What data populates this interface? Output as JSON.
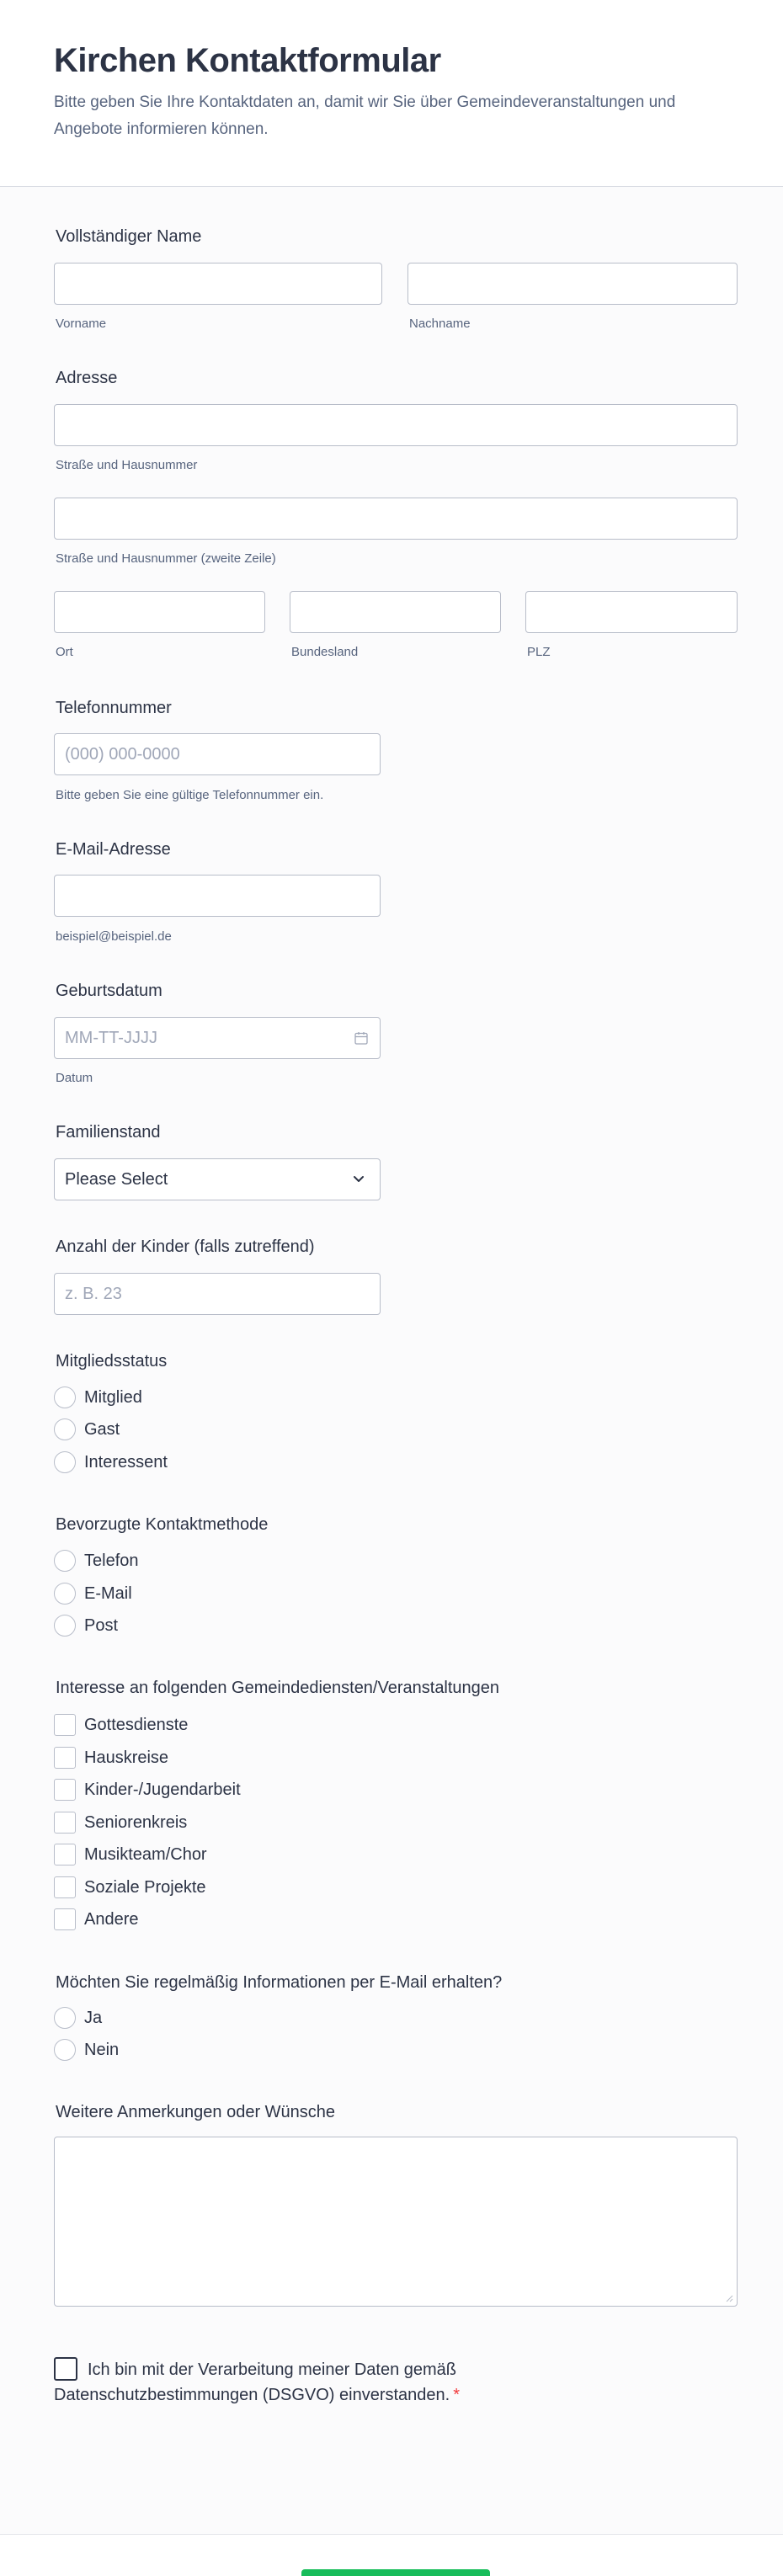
{
  "header": {
    "title": "Kirchen Kontaktformular",
    "subtitle": "Bitte geben Sie Ihre Kontaktdaten an, damit wir Sie über Gemeindeveranstaltungen und Angebote informieren können."
  },
  "name": {
    "label": "Vollständiger Name",
    "first_sublabel": "Vorname",
    "last_sublabel": "Nachname"
  },
  "address": {
    "label": "Adresse",
    "street_sublabel": "Straße und Hausnummer",
    "street2_sublabel": "Straße und Hausnummer (zweite Zeile)",
    "city_sublabel": "Ort",
    "state_sublabel": "Bundesland",
    "zip_sublabel": "PLZ"
  },
  "phone": {
    "label": "Telefonnummer",
    "placeholder": "(000) 000-0000",
    "sublabel": "Bitte geben Sie eine gültige Telefonnummer ein."
  },
  "email": {
    "label": "E-Mail-Adresse",
    "sublabel": "beispiel@beispiel.de"
  },
  "birthdate": {
    "label": "Geburtsdatum",
    "placeholder": "MM-TT-JJJJ",
    "sublabel": "Datum",
    "icon": "calendar-icon"
  },
  "marital": {
    "label": "Familienstand",
    "selected": "Please Select",
    "icon": "chevron-down-icon"
  },
  "children": {
    "label": "Anzahl der Kinder (falls zutreffend)",
    "placeholder": "z. B. 23"
  },
  "membership": {
    "label": "Mitgliedsstatus",
    "options": [
      "Mitglied",
      "Gast",
      "Interessent"
    ]
  },
  "contact_method": {
    "label": "Bevorzugte Kontaktmethode",
    "options": [
      "Telefon",
      "E-Mail",
      "Post"
    ]
  },
  "interests": {
    "label": "Interesse an folgenden Gemeindediensten/Veranstaltungen",
    "options": [
      "Gottesdienste",
      "Hauskreise",
      "Kinder-/Jugendarbeit",
      "Seniorenkreis",
      "Musikteam/Chor",
      "Soziale Projekte",
      "Andere"
    ]
  },
  "newsletter": {
    "label": "Möchten Sie regelmäßig Informationen per E-Mail erhalten?",
    "options": [
      "Ja",
      "Nein"
    ]
  },
  "comments": {
    "label": "Weitere Anmerkungen oder Wünsche"
  },
  "consent": {
    "text": "Ich bin mit der Verarbeitung meiner Daten gemäß Datenschutzbestimmungen (DSGVO) einverstanden.",
    "required_mark": "*"
  },
  "colors": {
    "accent": "#18bd5b",
    "required": "#f23a3c",
    "text": "#2c3345",
    "muted": "#57647e"
  }
}
